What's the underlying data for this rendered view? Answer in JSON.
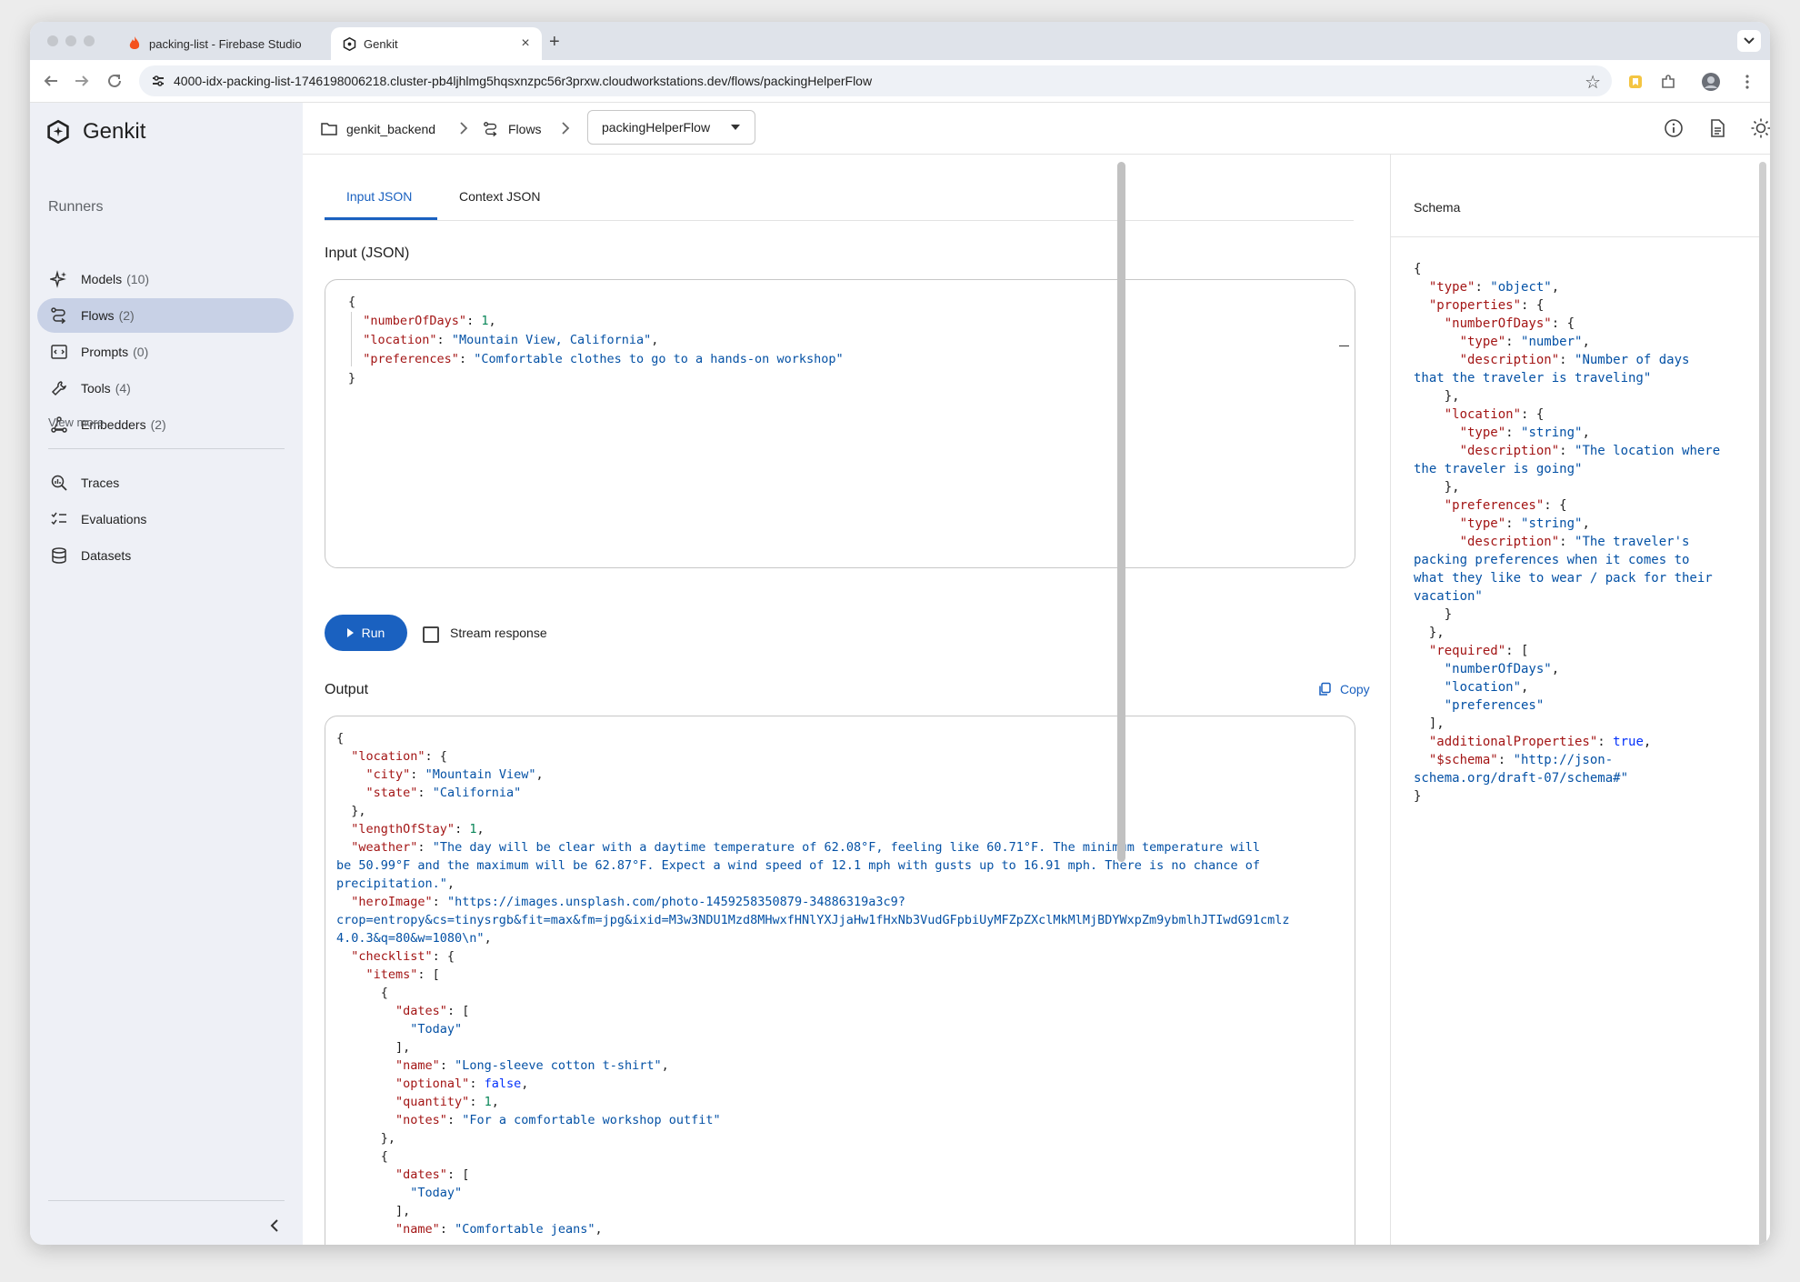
{
  "browser": {
    "tabs": [
      {
        "title": "packing-list - Firebase Studio",
        "active": false
      },
      {
        "title": "Genkit",
        "active": true
      }
    ],
    "new_tab": "+",
    "close": "×",
    "url": "4000-idx-packing-list-1746198006218.cluster-pb4ljhlmg5hqsxnzpc56r3prxw.cloudworkstations.dev/flows/packingHelperFlow"
  },
  "sidebar": {
    "app_name": "Genkit",
    "section_label": "Runners",
    "runners": [
      {
        "label": "Models",
        "count": "(10)",
        "icon": "sparkle-icon"
      },
      {
        "label": "Flows",
        "count": "(2)",
        "icon": "flows-icon",
        "active": true
      },
      {
        "label": "Prompts",
        "count": "(0)",
        "icon": "prompt-icon"
      },
      {
        "label": "Tools",
        "count": "(4)",
        "icon": "wrench-icon"
      },
      {
        "label": "Embedders",
        "count": "(2)",
        "icon": "embedder-icon"
      }
    ],
    "view_more": "View more",
    "tools": [
      {
        "label": "Traces",
        "icon": "traces-icon"
      },
      {
        "label": "Evaluations",
        "icon": "checklist-icon"
      },
      {
        "label": "Datasets",
        "icon": "database-icon"
      }
    ]
  },
  "header": {
    "breadcrumb": [
      "genkit_backend",
      "Flows"
    ],
    "flow_select": "packingHelperFlow"
  },
  "main": {
    "tabs": [
      "Input JSON",
      "Context JSON"
    ],
    "input_heading": "Input (JSON)",
    "input_json": [
      [
        [
          "p",
          "{"
        ]
      ],
      [
        [
          "p",
          "  "
        ],
        [
          "k",
          "\"numberOfDays\""
        ],
        [
          "p",
          ": "
        ],
        [
          "n",
          "1"
        ],
        [
          "p",
          ","
        ]
      ],
      [
        [
          "p",
          "  "
        ],
        [
          "k",
          "\"location\""
        ],
        [
          "p",
          ": "
        ],
        [
          "s",
          "\"Mountain View, California\""
        ],
        [
          "p",
          ","
        ]
      ],
      [
        [
          "p",
          "  "
        ],
        [
          "k",
          "\"preferences\""
        ],
        [
          "p",
          ": "
        ],
        [
          "s",
          "\"Comfortable clothes to go to a hands-on workshop\""
        ]
      ],
      [
        [
          "p",
          "}"
        ]
      ]
    ],
    "run_label": "Run",
    "stream_label": "Stream response",
    "output_heading": "Output",
    "copy_label": "Copy",
    "output_json": [
      [
        [
          "p",
          "{"
        ]
      ],
      [
        [
          "p",
          "  "
        ],
        [
          "k",
          "\"location\""
        ],
        [
          "p",
          ": {"
        ]
      ],
      [
        [
          "p",
          "    "
        ],
        [
          "k",
          "\"city\""
        ],
        [
          "p",
          ": "
        ],
        [
          "s",
          "\"Mountain View\""
        ],
        [
          "p",
          ","
        ]
      ],
      [
        [
          "p",
          "    "
        ],
        [
          "k",
          "\"state\""
        ],
        [
          "p",
          ": "
        ],
        [
          "s",
          "\"California\""
        ]
      ],
      [
        [
          "p",
          "  },"
        ]
      ],
      [
        [
          "p",
          "  "
        ],
        [
          "k",
          "\"lengthOfStay\""
        ],
        [
          "p",
          ": "
        ],
        [
          "n",
          "1"
        ],
        [
          "p",
          ","
        ]
      ],
      [
        [
          "p",
          "  "
        ],
        [
          "k",
          "\"weather\""
        ],
        [
          "p",
          ": "
        ],
        [
          "s",
          "\"The day will be clear with a daytime temperature of 62.08°F, feeling like 60.71°F. The minimum temperature will"
        ]
      ],
      [
        [
          "s",
          "be 50.99°F and the maximum will be 62.87°F. Expect a wind speed of 12.1 mph with gusts up to 16.91 mph. There is no chance of"
        ]
      ],
      [
        [
          "s",
          "precipitation.\""
        ],
        [
          "p",
          ","
        ]
      ],
      [
        [
          "p",
          "  "
        ],
        [
          "k",
          "\"heroImage\""
        ],
        [
          "p",
          ": "
        ],
        [
          "s",
          "\"https://images.unsplash.com/photo-1459258350879-34886319a3c9?"
        ]
      ],
      [
        [
          "s",
          "crop=entropy&cs=tinysrgb&fit=max&fm=jpg&ixid=M3w3NDU1Mzd8MHwxfHNlYXJjaHw1fHxNb3VudGFpbiUyMFZpZXclMkMlMjBDYWxpZm9ybmlhJTIwdG91cmlz"
        ]
      ],
      [
        [
          "s",
          "4.0.3&q=80&w=1080\\n\""
        ],
        [
          "p",
          ","
        ]
      ],
      [
        [
          "p",
          "  "
        ],
        [
          "k",
          "\"checklist\""
        ],
        [
          "p",
          ": {"
        ]
      ],
      [
        [
          "p",
          "    "
        ],
        [
          "k",
          "\"items\""
        ],
        [
          "p",
          ": ["
        ]
      ],
      [
        [
          "p",
          "      {"
        ]
      ],
      [
        [
          "p",
          "        "
        ],
        [
          "k",
          "\"dates\""
        ],
        [
          "p",
          ": ["
        ]
      ],
      [
        [
          "p",
          "          "
        ],
        [
          "s",
          "\"Today\""
        ]
      ],
      [
        [
          "p",
          "        ],"
        ]
      ],
      [
        [
          "p",
          "        "
        ],
        [
          "k",
          "\"name\""
        ],
        [
          "p",
          ": "
        ],
        [
          "s",
          "\"Long-sleeve cotton t-shirt\""
        ],
        [
          "p",
          ","
        ]
      ],
      [
        [
          "p",
          "        "
        ],
        [
          "k",
          "\"optional\""
        ],
        [
          "p",
          ": "
        ],
        [
          "b",
          "false"
        ],
        [
          "p",
          ","
        ]
      ],
      [
        [
          "p",
          "        "
        ],
        [
          "k",
          "\"quantity\""
        ],
        [
          "p",
          ": "
        ],
        [
          "n",
          "1"
        ],
        [
          "p",
          ","
        ]
      ],
      [
        [
          "p",
          "        "
        ],
        [
          "k",
          "\"notes\""
        ],
        [
          "p",
          ": "
        ],
        [
          "s",
          "\"For a comfortable workshop outfit\""
        ]
      ],
      [
        [
          "p",
          "      },"
        ]
      ],
      [
        [
          "p",
          "      {"
        ]
      ],
      [
        [
          "p",
          "        "
        ],
        [
          "k",
          "\"dates\""
        ],
        [
          "p",
          ": ["
        ]
      ],
      [
        [
          "p",
          "          "
        ],
        [
          "s",
          "\"Today\""
        ]
      ],
      [
        [
          "p",
          "        ],"
        ]
      ],
      [
        [
          "p",
          "        "
        ],
        [
          "k",
          "\"name\""
        ],
        [
          "p",
          ": "
        ],
        [
          "s",
          "\"Comfortable jeans\""
        ],
        [
          "p",
          ","
        ]
      ]
    ]
  },
  "schema": {
    "title": "Schema",
    "json": [
      [
        [
          "p",
          "{"
        ]
      ],
      [
        [
          "p",
          "  "
        ],
        [
          "k",
          "\"type\""
        ],
        [
          "p",
          ": "
        ],
        [
          "s",
          "\"object\""
        ],
        [
          "p",
          ","
        ]
      ],
      [
        [
          "p",
          "  "
        ],
        [
          "k",
          "\"properties\""
        ],
        [
          "p",
          ": {"
        ]
      ],
      [
        [
          "p",
          "    "
        ],
        [
          "k",
          "\"numberOfDays\""
        ],
        [
          "p",
          ": {"
        ]
      ],
      [
        [
          "p",
          "      "
        ],
        [
          "k",
          "\"type\""
        ],
        [
          "p",
          ": "
        ],
        [
          "s",
          "\"number\""
        ],
        [
          "p",
          ","
        ]
      ],
      [
        [
          "p",
          "      "
        ],
        [
          "k",
          "\"description\""
        ],
        [
          "p",
          ": "
        ],
        [
          "s",
          "\"Number of days"
        ]
      ],
      [
        [
          "s",
          "that the traveler is traveling\""
        ]
      ],
      [
        [
          "p",
          "    },"
        ]
      ],
      [
        [
          "p",
          "    "
        ],
        [
          "k",
          "\"location\""
        ],
        [
          "p",
          ": {"
        ]
      ],
      [
        [
          "p",
          "      "
        ],
        [
          "k",
          "\"type\""
        ],
        [
          "p",
          ": "
        ],
        [
          "s",
          "\"string\""
        ],
        [
          "p",
          ","
        ]
      ],
      [
        [
          "p",
          "      "
        ],
        [
          "k",
          "\"description\""
        ],
        [
          "p",
          ": "
        ],
        [
          "s",
          "\"The location where"
        ]
      ],
      [
        [
          "s",
          "the traveler is going\""
        ]
      ],
      [
        [
          "p",
          "    },"
        ]
      ],
      [
        [
          "p",
          "    "
        ],
        [
          "k",
          "\"preferences\""
        ],
        [
          "p",
          ": {"
        ]
      ],
      [
        [
          "p",
          "      "
        ],
        [
          "k",
          "\"type\""
        ],
        [
          "p",
          ": "
        ],
        [
          "s",
          "\"string\""
        ],
        [
          "p",
          ","
        ]
      ],
      [
        [
          "p",
          "      "
        ],
        [
          "k",
          "\"description\""
        ],
        [
          "p",
          ": "
        ],
        [
          "s",
          "\"The traveler's"
        ]
      ],
      [
        [
          "s",
          "packing preferences when it comes to"
        ]
      ],
      [
        [
          "s",
          "what they like to wear / pack for their"
        ]
      ],
      [
        [
          "s",
          "vacation\""
        ]
      ],
      [
        [
          "p",
          "    }"
        ]
      ],
      [
        [
          "p",
          "  },"
        ]
      ],
      [
        [
          "p",
          "  "
        ],
        [
          "k",
          "\"required\""
        ],
        [
          "p",
          ": ["
        ]
      ],
      [
        [
          "p",
          "    "
        ],
        [
          "s",
          "\"numberOfDays\""
        ],
        [
          "p",
          ","
        ]
      ],
      [
        [
          "p",
          "    "
        ],
        [
          "s",
          "\"location\""
        ],
        [
          "p",
          ","
        ]
      ],
      [
        [
          "p",
          "    "
        ],
        [
          "s",
          "\"preferences\""
        ]
      ],
      [
        [
          "p",
          "  ],"
        ]
      ],
      [
        [
          "p",
          "  "
        ],
        [
          "k",
          "\"additionalProperties\""
        ],
        [
          "p",
          ": "
        ],
        [
          "b",
          "true"
        ],
        [
          "p",
          ","
        ]
      ],
      [
        [
          "p",
          "  "
        ],
        [
          "k",
          "\"$schema\""
        ],
        [
          "p",
          ": "
        ],
        [
          "s",
          "\"http://json-"
        ]
      ],
      [
        [
          "s",
          "schema.org/draft-07/schema#\""
        ]
      ],
      [
        [
          "p",
          "}"
        ]
      ]
    ]
  },
  "colors": {
    "accent": "#1a61c0",
    "sidebar_bg": "#eef0f6",
    "active_nav": "#c8d1e6",
    "json_key": "#a31515",
    "json_string": "#0451a5",
    "json_number": "#098658"
  }
}
